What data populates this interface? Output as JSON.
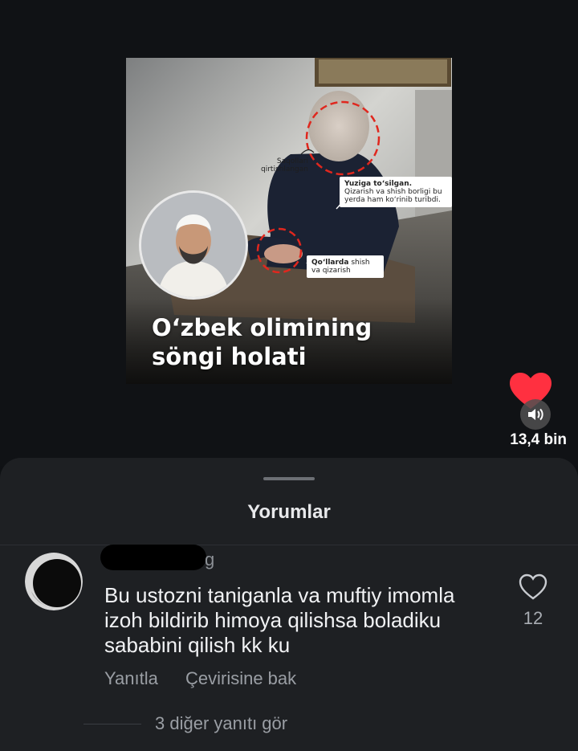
{
  "post": {
    "headline": "O‘zbek olimining\nsöngi holati",
    "callouts": {
      "beard": {
        "text": "Saqollari\nqirtishlangan"
      },
      "face": {
        "title": "Yuziga to‘silgan.",
        "text": "Qizarish va shish borligi bu yerda ham ko‘rinib turibdi."
      },
      "hands": {
        "title": "Qo‘llarda",
        "text": "shish va qizarish"
      }
    }
  },
  "actions": {
    "like_count": "13,4 bin",
    "like_color": "#ff3040"
  },
  "comments_sheet": {
    "title": "Yorumlar",
    "comment": {
      "username_tail": "g",
      "text": "Bu ustozni taniganla va muftiy imomla izoh bildirib himoya qilishsa boladiku sababini qilish kk ku",
      "like_count": "12",
      "reply_label": "Yanıtla",
      "translate_label": "Çevirisine bak"
    },
    "more_replies_label": "3 diğer yanıtı gör"
  }
}
